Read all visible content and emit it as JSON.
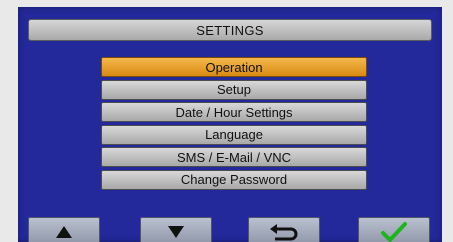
{
  "header": {
    "title": "SETTINGS"
  },
  "menu": {
    "items": [
      {
        "label": "Operation",
        "selected": true
      },
      {
        "label": "Setup",
        "selected": false
      },
      {
        "label": "Date / Hour Settings",
        "selected": false
      },
      {
        "label": "Language",
        "selected": false
      },
      {
        "label": "SMS / E-Mail / VNC",
        "selected": false
      },
      {
        "label": "Change Password",
        "selected": false
      }
    ]
  },
  "buttons": {
    "up_icon": "up-triangle-icon",
    "down_icon": "down-triangle-icon",
    "back_icon": "return-arrow-icon",
    "confirm_icon": "checkmark-icon"
  },
  "colors": {
    "screen_bg": "#23289a",
    "selected_item": "#e9a02c",
    "confirm_green": "#1db51d"
  }
}
